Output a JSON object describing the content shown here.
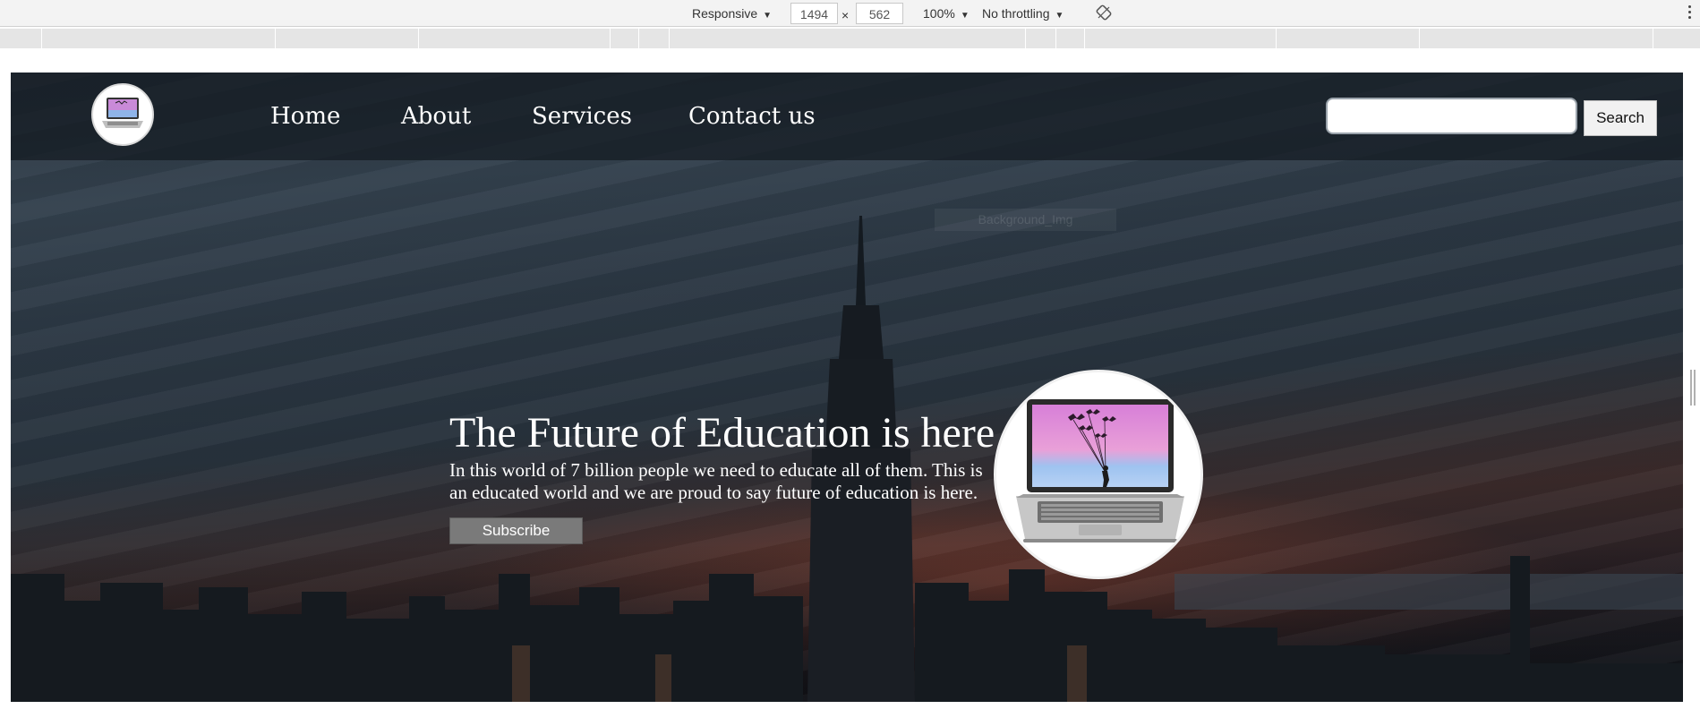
{
  "devtools": {
    "device_mode": "Responsive",
    "width": "1494",
    "separator": "×",
    "height": "562",
    "zoom": "100%",
    "throttling": "No throttling",
    "rotate_icon": "rotate-icon",
    "menu_icon": "kebab-menu-icon"
  },
  "nav": {
    "logo_icon": "laptop-logo-icon",
    "links": [
      "Home",
      "About",
      "Services",
      "Contact us"
    ],
    "search_placeholder": "",
    "search_button": "Search"
  },
  "ghost_label": "Background_Img",
  "hero": {
    "title": "The Future of Education is here",
    "text": "In this world of 7 billion people we need to educate all of them. This is an educated world and we are proud to say future of education is here.",
    "subscribe": "Subscribe",
    "image_icon": "laptop-image-icon"
  },
  "colors": {
    "nav_overlay": "#141a21",
    "button_gray": "#7a7a7a",
    "text": "#ffffff"
  }
}
